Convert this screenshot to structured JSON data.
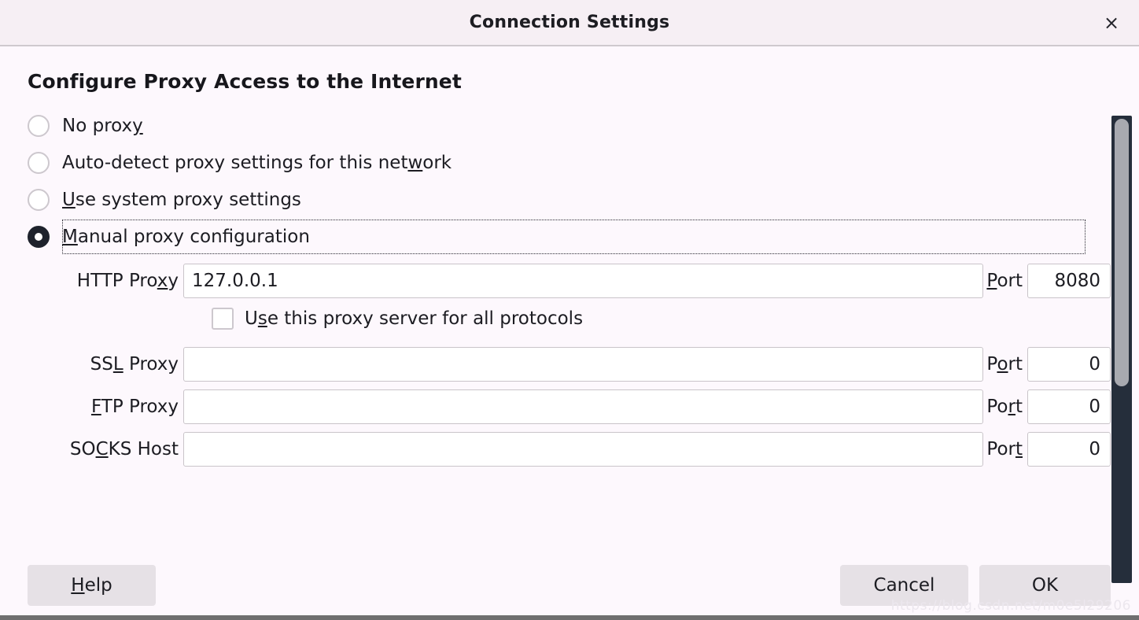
{
  "titlebar": {
    "title": "Connection Settings",
    "close_label": "×"
  },
  "section": {
    "heading": "Configure Proxy Access to the Internet"
  },
  "proxy_modes": [
    {
      "label_before": "No prox",
      "accel": "y",
      "label_after": "",
      "checked": false
    },
    {
      "label_before": "Auto-detect proxy settings for this net",
      "accel": "w",
      "label_after": "ork",
      "checked": false
    },
    {
      "label_before": "",
      "accel": "U",
      "label_after": "se system proxy settings",
      "checked": false
    },
    {
      "label_before": "",
      "accel": "M",
      "label_after": "anual proxy configuration",
      "checked": true
    }
  ],
  "fields": [
    {
      "label_before": "HTTP Pro",
      "accel": "x",
      "label_after": "y",
      "value": "127.0.0.1",
      "port_before": "",
      "port_accel": "P",
      "port_after": "ort",
      "port_value": "8080"
    },
    {
      "label_before": "SS",
      "accel": "L",
      "label_after": " Proxy",
      "value": "",
      "port_before": "P",
      "port_accel": "o",
      "port_after": "rt",
      "port_value": "0"
    },
    {
      "label_before": "",
      "accel": "F",
      "label_after": "TP Proxy",
      "value": "",
      "port_before": "Po",
      "port_accel": "r",
      "port_after": "t",
      "port_value": "0"
    },
    {
      "label_before": "SO",
      "accel": "C",
      "label_after": "KS Host",
      "value": "",
      "port_before": "Por",
      "port_accel": "t",
      "port_after": "",
      "port_value": "0"
    }
  ],
  "all_protocols_checkbox": {
    "label_before": "U",
    "accel": "s",
    "label_after": "e this proxy server for all protocols",
    "checked": false
  },
  "buttons": {
    "help_before": "",
    "help_accel": "H",
    "help_after": "elp",
    "cancel": "Cancel",
    "ok": "OK"
  },
  "watermark": "https://blog.csdn.net/m0e5l29206",
  "colors": {
    "dialog_bg": "#fdf8fd",
    "titlebar_bg": "#f6eff4",
    "button_bg": "#e6e1e6",
    "scrollbar_track": "#252e3b",
    "scrollbar_thumb": "#a8aab0",
    "text": "#1c1c22"
  }
}
